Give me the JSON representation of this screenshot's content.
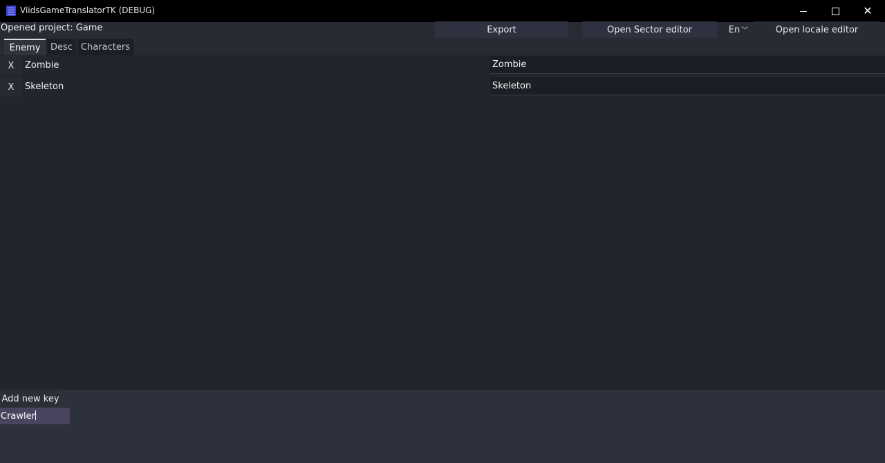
{
  "window": {
    "title": "ViidsGameTranslatorTK (DEBUG)"
  },
  "header": {
    "project_label": "Opened project: Game",
    "export_label": "Export",
    "sector_editor_label": "Open Sector editor",
    "language_selected": "En",
    "locale_editor_label": "Open locale editor"
  },
  "tabs": [
    {
      "label": "Enemy",
      "active": true
    },
    {
      "label": "Desc",
      "active": false
    },
    {
      "label": "Characters",
      "active": false
    }
  ],
  "rows": [
    {
      "delete_label": "X",
      "key": "Zombie",
      "value": "Zombie"
    },
    {
      "delete_label": "X",
      "key": "Skeleton",
      "value": "Skeleton"
    }
  ],
  "footer": {
    "add_key_label": "Add new key",
    "new_key_value": "Crawler"
  },
  "colors": {
    "background": "#21252d",
    "titlebar": "#000000",
    "input_active": "#4a4460",
    "button": "#2e3140"
  }
}
